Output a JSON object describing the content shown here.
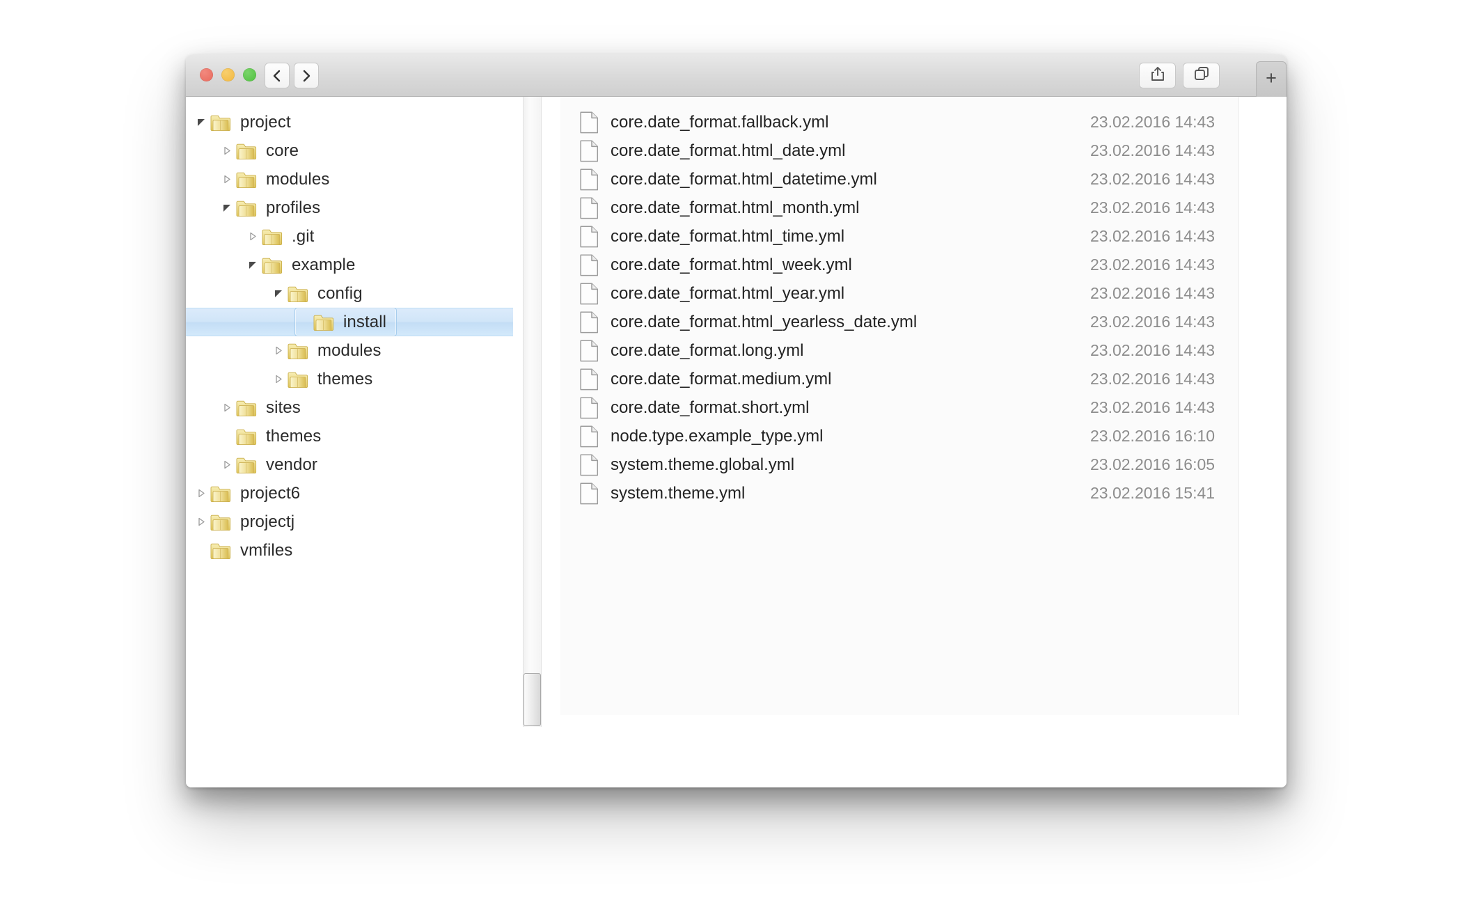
{
  "window": {
    "titlebar": {
      "traffic_lights": [
        {
          "name": "close",
          "color": "#e8695c"
        },
        {
          "name": "minimize",
          "color": "#f2b73e"
        },
        {
          "name": "maximize",
          "color": "#4fc03f"
        }
      ],
      "nav_back_icon": "chevron-left-icon",
      "nav_forward_icon": "chevron-right-icon",
      "address": {
        "value": "",
        "placeholder": ""
      },
      "share_icon": "share-icon",
      "duplicate_icon": "duplicate-window-icon",
      "new_tab_label": "+"
    }
  },
  "sidebar": {
    "items": [
      {
        "label": "project",
        "depth": 0,
        "state": "expanded"
      },
      {
        "label": "core",
        "depth": 1,
        "state": "collapsed"
      },
      {
        "label": "modules",
        "depth": 1,
        "state": "collapsed"
      },
      {
        "label": "profiles",
        "depth": 1,
        "state": "expanded"
      },
      {
        "label": ".git",
        "depth": 2,
        "state": "collapsed"
      },
      {
        "label": "example",
        "depth": 2,
        "state": "expanded"
      },
      {
        "label": "config",
        "depth": 3,
        "state": "expanded"
      },
      {
        "label": "install",
        "depth": 4,
        "state": "leaf",
        "selected": true
      },
      {
        "label": "modules",
        "depth": 3,
        "state": "collapsed"
      },
      {
        "label": "themes",
        "depth": 3,
        "state": "collapsed"
      },
      {
        "label": "sites",
        "depth": 1,
        "state": "collapsed"
      },
      {
        "label": "themes",
        "depth": 1,
        "state": "leaf"
      },
      {
        "label": "vendor",
        "depth": 1,
        "state": "collapsed"
      },
      {
        "label": "project6",
        "depth": 0,
        "state": "collapsed"
      },
      {
        "label": "projectj",
        "depth": 0,
        "state": "collapsed"
      },
      {
        "label": "vmfiles",
        "depth": 0,
        "state": "leaf"
      }
    ]
  },
  "filelist": {
    "rows": [
      {
        "name": "core.date_format.fallback.yml",
        "date": "23.02.2016 14:43"
      },
      {
        "name": "core.date_format.html_date.yml",
        "date": "23.02.2016 14:43"
      },
      {
        "name": "core.date_format.html_datetime.yml",
        "date": "23.02.2016 14:43"
      },
      {
        "name": "core.date_format.html_month.yml",
        "date": "23.02.2016 14:43"
      },
      {
        "name": "core.date_format.html_time.yml",
        "date": "23.02.2016 14:43"
      },
      {
        "name": "core.date_format.html_week.yml",
        "date": "23.02.2016 14:43"
      },
      {
        "name": "core.date_format.html_year.yml",
        "date": "23.02.2016 14:43"
      },
      {
        "name": "core.date_format.html_yearless_date.yml",
        "date": "23.02.2016 14:43"
      },
      {
        "name": "core.date_format.long.yml",
        "date": "23.02.2016 14:43"
      },
      {
        "name": "core.date_format.medium.yml",
        "date": "23.02.2016 14:43"
      },
      {
        "name": "core.date_format.short.yml",
        "date": "23.02.2016 14:43"
      },
      {
        "name": "node.type.example_type.yml",
        "date": "23.02.2016 16:10"
      },
      {
        "name": "system.theme.global.yml",
        "date": "23.02.2016 16:05"
      },
      {
        "name": "system.theme.yml",
        "date": "23.02.2016 15:41"
      }
    ]
  },
  "scrollbar": {
    "orientation": "vertical",
    "thumb_position": "bottom"
  },
  "colors": {
    "selection_fill": "#d0e5f8",
    "selection_border": "#a7cded",
    "folder": "#e8d27a",
    "titlebar": "#d9d9d9"
  }
}
